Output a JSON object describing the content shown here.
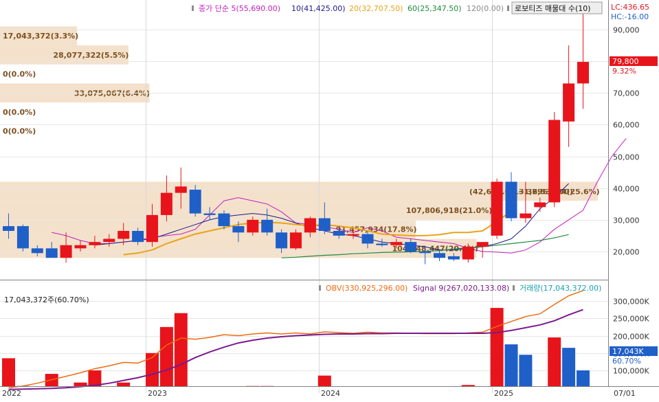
{
  "legend_price": {
    "ma5": "종가 단순 5(55,690.00)",
    "ma10": "10(41,425.00)",
    "ma20": "20(32,707.50)",
    "ma60": "60(25,347.50)",
    "ma120": "120(0.00)",
    "title_box": "로보티즈 매물대 수(10)"
  },
  "legend_volume": {
    "obv": "OBV(330,925,296.00)",
    "signal": "Signal 9(267,020,133.08)",
    "volume": "거래량(17,043,372.00)"
  },
  "right_info": {
    "lc": "LC:436.65",
    "hc": "HC:-16.00",
    "price_tag": "79,800",
    "price_pct": "9.32%",
    "vol_tag": "17,043K",
    "vol_pct": "60.70%"
  },
  "volume_panel_label": "17,043,372주(60.70%)",
  "colors": {
    "up": "#e8141b",
    "down": "#1f5fc8",
    "ma5": "#c21fbd",
    "ma10": "#1a1a8c",
    "ma20": "#e8a317",
    "ma60": "#1f8a3c",
    "obv": "#ec6a12",
    "signal": "#7a1a8c",
    "profile": "#f2dcc2",
    "profile_text": "#7a5020"
  },
  "chart_data": [
    {
      "type": "candlestick",
      "title": "로보티즈",
      "y_ticks": [
        20000,
        30000,
        40000,
        50000,
        60000,
        70000,
        80000,
        90000
      ],
      "y_tick_labels": [
        "20,000",
        "30,000",
        "40,000",
        "50,000",
        "60,000",
        "70,000",
        "80,000",
        "90,000"
      ],
      "x_labels": [
        "2022",
        "2023",
        "2024",
        "2025",
        "07/01"
      ],
      "candles": [
        {
          "o": 28000,
          "h": 32000,
          "l": 24000,
          "c": 26500
        },
        {
          "o": 28000,
          "h": 28500,
          "l": 20000,
          "c": 21000
        },
        {
          "o": 21000,
          "h": 22000,
          "l": 18500,
          "c": 19500
        },
        {
          "o": 21000,
          "h": 23000,
          "l": 18000,
          "c": 18000
        },
        {
          "o": 18000,
          "h": 26000,
          "l": 16500,
          "c": 22000
        },
        {
          "o": 21000,
          "h": 23500,
          "l": 20000,
          "c": 22000
        },
        {
          "o": 22000,
          "h": 25000,
          "l": 21000,
          "c": 23000
        },
        {
          "o": 23000,
          "h": 25500,
          "l": 21500,
          "c": 24000
        },
        {
          "o": 24000,
          "h": 29000,
          "l": 22000,
          "c": 26500
        },
        {
          "o": 26500,
          "h": 27500,
          "l": 22000,
          "c": 23000
        },
        {
          "o": 23000,
          "h": 35000,
          "l": 21500,
          "c": 31500
        },
        {
          "o": 31500,
          "h": 44000,
          "l": 29500,
          "c": 38500
        },
        {
          "o": 38500,
          "h": 46500,
          "l": 33500,
          "c": 40500
        },
        {
          "o": 39500,
          "h": 41000,
          "l": 31000,
          "c": 32000
        },
        {
          "o": 32000,
          "h": 34000,
          "l": 30000,
          "c": 31500
        },
        {
          "o": 32000,
          "h": 33000,
          "l": 27000,
          "c": 28000
        },
        {
          "o": 28000,
          "h": 29500,
          "l": 23000,
          "c": 26000
        },
        {
          "o": 26000,
          "h": 31000,
          "l": 25000,
          "c": 30000
        },
        {
          "o": 30000,
          "h": 33500,
          "l": 25000,
          "c": 26000
        },
        {
          "o": 26000,
          "h": 27000,
          "l": 19500,
          "c": 21000
        },
        {
          "o": 21000,
          "h": 27000,
          "l": 20500,
          "c": 26000
        },
        {
          "o": 26000,
          "h": 31000,
          "l": 24500,
          "c": 30500
        },
        {
          "o": 30500,
          "h": 35500,
          "l": 25500,
          "c": 26500
        },
        {
          "o": 26500,
          "h": 28000,
          "l": 24000,
          "c": 25000
        },
        {
          "o": 25000,
          "h": 27000,
          "l": 24000,
          "c": 25500
        },
        {
          "o": 25500,
          "h": 26500,
          "l": 21000,
          "c": 22500
        },
        {
          "o": 22500,
          "h": 24000,
          "l": 21500,
          "c": 22000
        },
        {
          "o": 22000,
          "h": 24000,
          "l": 21000,
          "c": 23000
        },
        {
          "o": 23000,
          "h": 24000,
          "l": 19500,
          "c": 20000
        },
        {
          "o": 20000,
          "h": 21500,
          "l": 16000,
          "c": 19500
        },
        {
          "o": 19500,
          "h": 20500,
          "l": 17000,
          "c": 18000
        },
        {
          "o": 18500,
          "h": 19500,
          "l": 17000,
          "c": 17500
        },
        {
          "o": 17500,
          "h": 22500,
          "l": 16500,
          "c": 21500
        },
        {
          "o": 21500,
          "h": 22500,
          "l": 18000,
          "c": 23000
        },
        {
          "o": 25000,
          "h": 43000,
          "l": 24000,
          "c": 42000
        },
        {
          "o": 42000,
          "h": 45000,
          "l": 29500,
          "c": 30500
        },
        {
          "o": 30500,
          "h": 42000,
          "l": 29000,
          "c": 32000
        },
        {
          "o": 34000,
          "h": 37000,
          "l": 32500,
          "c": 35500
        },
        {
          "o": 35500,
          "h": 64000,
          "l": 34000,
          "c": 61500
        },
        {
          "o": 61000,
          "h": 85000,
          "l": 53000,
          "c": 73000
        },
        {
          "o": 73000,
          "h": 95000,
          "l": 65000,
          "c": 79800
        }
      ],
      "moving_averages": {
        "ma5": {
          "start": 3,
          "values": [
            26000,
            25000,
            23500,
            22500,
            22500,
            23000,
            23500,
            24500,
            25000,
            25500,
            27000,
            31500,
            36000,
            37000,
            36000,
            35000,
            32500,
            29000,
            28500,
            27800,
            27000,
            26000,
            27500,
            26500,
            24500,
            24000,
            23500,
            23000,
            22500,
            21000,
            20000,
            19800,
            19500,
            20500,
            23000,
            27000,
            30000,
            33000,
            42000,
            50000,
            55690
          ]
        },
        "ma10": {
          "start": 6,
          "values": [
            22000,
            22500,
            23000,
            23500,
            24000,
            25500,
            27000,
            28500,
            30000,
            31000,
            31500,
            32000,
            31500,
            30500,
            29000,
            27500,
            26500,
            25500,
            25000,
            24000,
            23000,
            22500,
            22000,
            21500,
            20500,
            20500,
            21000,
            21500,
            22500,
            24000,
            28000,
            33500,
            37000,
            41425
          ]
        },
        "ma20": {
          "start": 8,
          "values": [
            19000,
            19500,
            20500,
            22500,
            24000,
            25500,
            26500,
            27500,
            28500,
            29000,
            29200,
            29000,
            28500,
            28200,
            28500,
            28000,
            27500,
            26500,
            25500,
            25200,
            25000,
            25000,
            25300,
            26000,
            26000,
            26500,
            29500,
            32707.5
          ]
        },
        "ma60": {
          "start": 19,
          "values": [
            18000,
            18200,
            18500,
            18800,
            19000,
            19300,
            19500,
            19700,
            19800,
            19900,
            20000,
            20300,
            20800,
            21200,
            21500,
            22000,
            22500,
            23000,
            23500,
            24300,
            25347.5
          ]
        }
      },
      "volume_profile": [
        {
          "label": "17,043,372(3.3%)",
          "pct": 3.3,
          "low": 85000,
          "high": 91000
        },
        {
          "label": "28,077,322(5.5%)",
          "pct": 5.5,
          "low": 79000,
          "high": 85000
        },
        {
          "label": "0(0.0%)",
          "pct": 0.0,
          "low": 73000,
          "high": 79000
        },
        {
          "label": "33,075,067(6.4%)",
          "pct": 6.4,
          "low": 67000,
          "high": 73000
        },
        {
          "label": "0(0.0%)",
          "pct": 0.0,
          "low": 61000,
          "high": 67000
        },
        {
          "label": "0(0.0%)",
          "pct": 0.0,
          "low": 55000,
          "high": 61000
        },
        {
          "label": "131,296,974(25.6%)",
          "pct": 25.6,
          "low": 36000,
          "high": 42000
        },
        {
          "label": "107,806,918(21.0%)",
          "pct": 21.0,
          "low": 30000,
          "high": 36000
        },
        {
          "label": "91,457,934(17.8%)",
          "pct": 17.8,
          "low": 24000,
          "high": 30000
        },
        {
          "label": "104,548,447(20.4%)",
          "pct": 20.4,
          "low": 18000,
          "high": 24000
        }
      ],
      "annotation": "(42,690.00 ~ 36,530.00)"
    },
    {
      "type": "bar",
      "title": "거래량",
      "y_ticks": [
        100000000,
        150000000,
        200000000,
        250000000,
        300000000
      ],
      "y_tick_labels": [
        "100,000K",
        "150,000K",
        "200,000K",
        "250,000K",
        "300,000K"
      ],
      "volumes": [
        {
          "v": 135,
          "up": true
        },
        {
          "v": 55,
          "up": false
        },
        {
          "v": 45,
          "up": false
        },
        {
          "v": 90,
          "up": true
        },
        {
          "v": 35,
          "up": false
        },
        {
          "v": 65,
          "up": true
        },
        {
          "v": 100,
          "up": true
        },
        {
          "v": 50,
          "up": false
        },
        {
          "v": 65,
          "up": true
        },
        {
          "v": 35,
          "up": false
        },
        {
          "v": 150,
          "up": true
        },
        {
          "v": 225,
          "up": true
        },
        {
          "v": 265,
          "up": true
        },
        {
          "v": 50,
          "up": false
        },
        {
          "v": 30,
          "up": false
        },
        {
          "v": 25,
          "up": false
        },
        {
          "v": 30,
          "up": true
        },
        {
          "v": 55,
          "up": true
        },
        {
          "v": 55,
          "up": true
        },
        {
          "v": 15,
          "up": false
        },
        {
          "v": 50,
          "up": true
        },
        {
          "v": 40,
          "up": false
        },
        {
          "v": 85,
          "up": true
        },
        {
          "v": 40,
          "up": false
        },
        {
          "v": 22,
          "up": false
        },
        {
          "v": 28,
          "up": true
        },
        {
          "v": 12,
          "up": false
        },
        {
          "v": 12,
          "up": false
        },
        {
          "v": 10,
          "up": false
        },
        {
          "v": 8,
          "up": false
        },
        {
          "v": 5,
          "up": false
        },
        {
          "v": 5,
          "up": false
        },
        {
          "v": 58,
          "up": true
        },
        {
          "v": 32,
          "up": false
        },
        {
          "v": 280,
          "up": true
        },
        {
          "v": 175,
          "up": false
        },
        {
          "v": 145,
          "up": false
        },
        {
          "v": 45,
          "up": false
        },
        {
          "v": 195,
          "up": true
        },
        {
          "v": 165,
          "up": false
        },
        {
          "v": 100,
          "up": false
        }
      ],
      "obv_line": [
        5,
        10,
        18,
        28,
        38,
        48,
        60,
        68,
        78,
        76,
        92,
        128,
        148,
        145,
        150,
        158,
        155,
        160,
        163,
        160,
        163,
        160,
        166,
        164,
        162,
        165,
        163,
        163,
        162,
        161,
        161,
        161,
        163,
        165,
        182,
        196,
        210,
        218,
        245,
        270,
        285
      ],
      "signal_line": [
        0,
        1,
        2,
        3,
        5,
        8,
        12,
        18,
        26,
        34,
        44,
        56,
        72,
        92,
        108,
        122,
        134,
        142,
        148,
        152,
        155,
        157,
        159,
        160,
        160,
        161,
        161,
        162,
        162,
        162,
        162,
        162,
        162,
        162,
        164,
        170,
        178,
        186,
        198,
        215,
        230
      ]
    }
  ]
}
